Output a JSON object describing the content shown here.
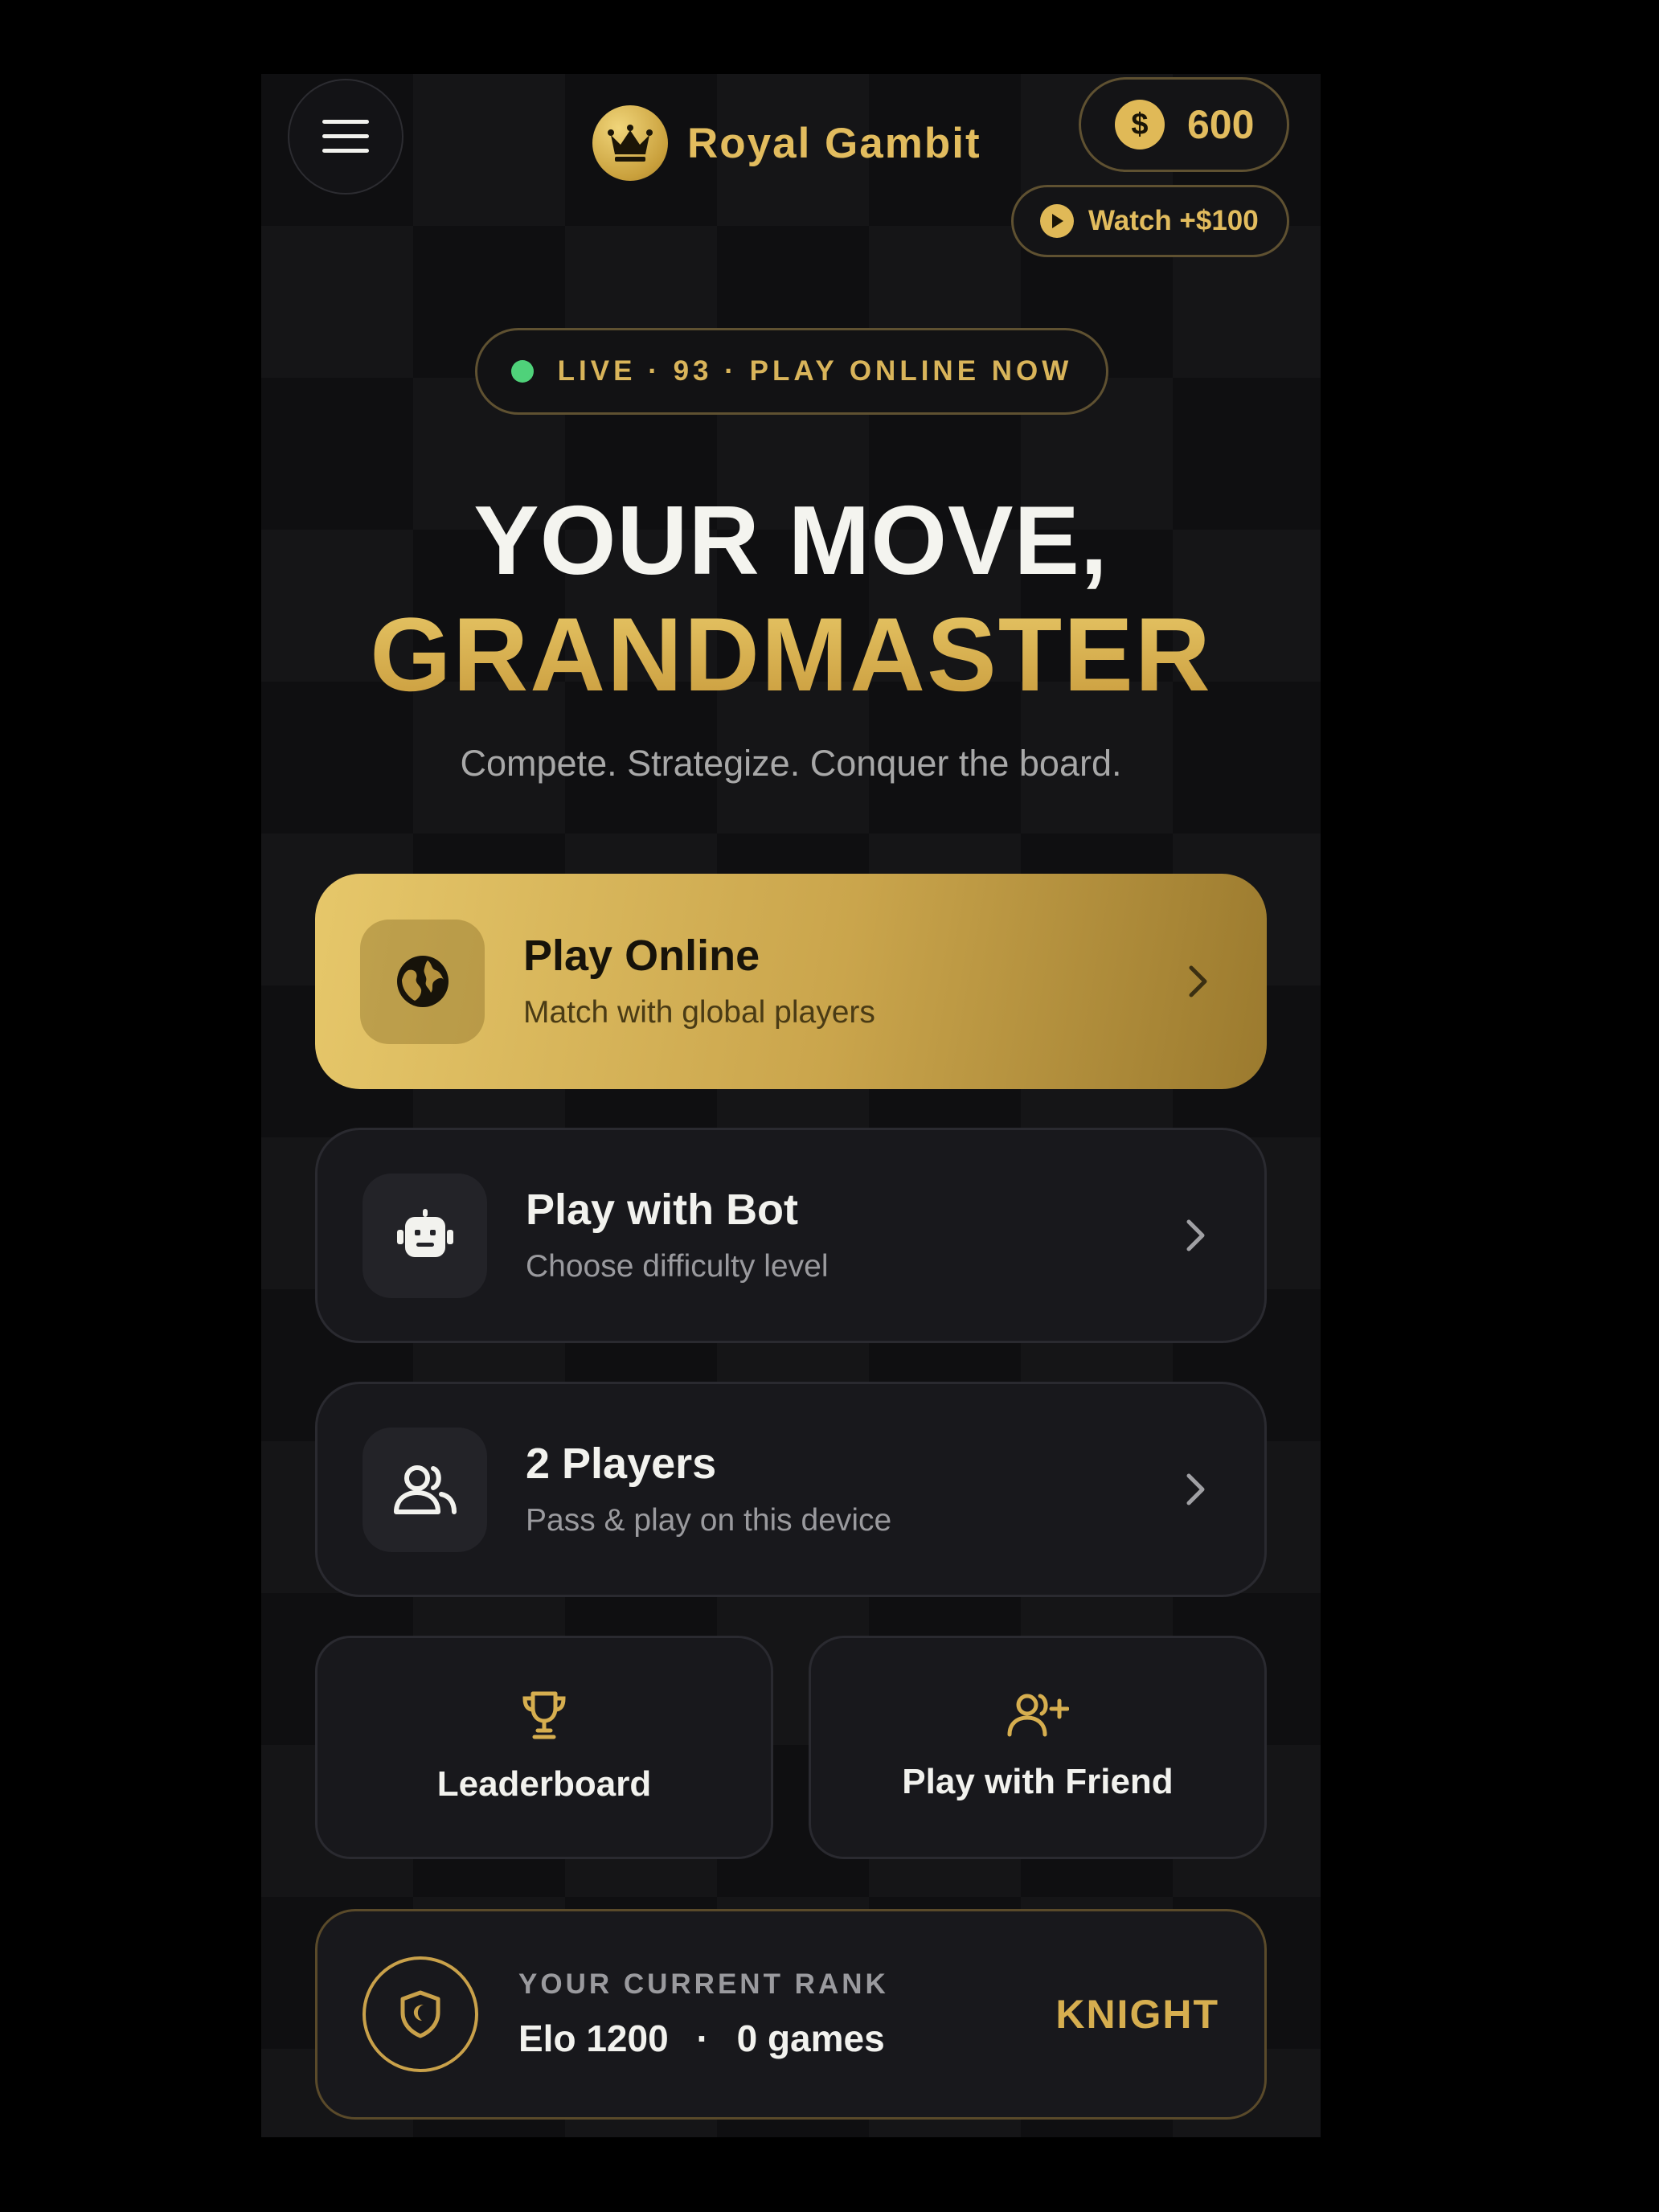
{
  "header": {
    "app_title": "Royal Gambit",
    "coins": "600",
    "coin_symbol": "$",
    "watch_label": "Watch +$100"
  },
  "live_badge": "LIVE · 93 · PLAY ONLINE NOW",
  "hero": {
    "line1": "YOUR MOVE,",
    "line2": "GRANDMASTER",
    "tagline": "Compete. Strategize. Conquer the board."
  },
  "modes": [
    {
      "title": "Play Online",
      "subtitle": "Match with global players",
      "icon": "globe-icon"
    },
    {
      "title": "Play with Bot",
      "subtitle": "Choose difficulty level",
      "icon": "robot-icon"
    },
    {
      "title": "2 Players",
      "subtitle": "Pass & play on this device",
      "icon": "users-icon"
    }
  ],
  "tiles": [
    {
      "label": "Leaderboard",
      "icon": "trophy-icon"
    },
    {
      "label": "Play with Friend",
      "icon": "user-plus-icon"
    }
  ],
  "rank": {
    "caption": "YOUR CURRENT RANK",
    "elo": "Elo 1200",
    "separator": "·",
    "games": "0 games",
    "title": "KNIGHT"
  },
  "colors": {
    "gold": "#d6ae4f",
    "background": "#111113",
    "live_dot": "#4fd27a"
  }
}
